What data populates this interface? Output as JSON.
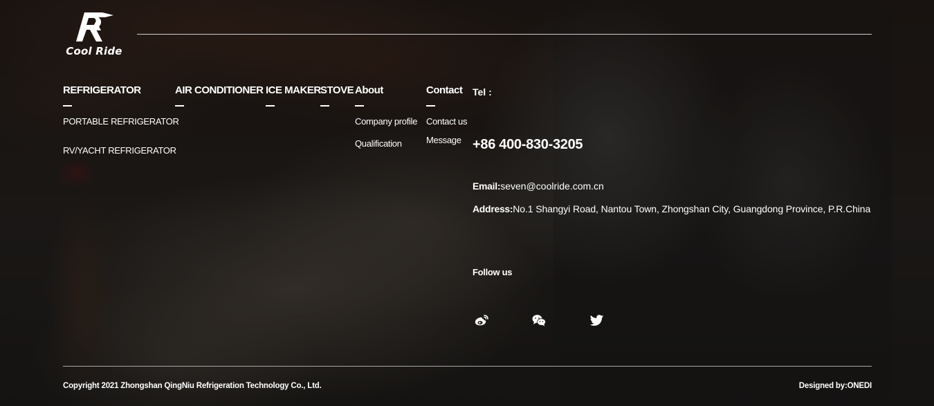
{
  "brand": {
    "name": "Cool Ride"
  },
  "nav": {
    "columns": [
      {
        "title": "REFRIGERATOR",
        "links": [
          "PORTABLE REFRIGERATOR",
          "RV/YACHT REFRIGERATOR"
        ]
      },
      {
        "title": "AIR CONDITIONER",
        "links": []
      },
      {
        "title": "ICE MAKER",
        "links": []
      },
      {
        "title": "STOVE",
        "links": []
      },
      {
        "title": "About",
        "links": [
          "Company profile",
          "Qualification"
        ]
      },
      {
        "title": "Contact",
        "links": [
          "Contact us",
          "Message"
        ]
      }
    ]
  },
  "contact": {
    "tel_label": "Tel :",
    "tel": "+86 400-830-3205",
    "email_label": "Email:",
    "email": "seven@coolride.com.cn",
    "address_label": "Address:",
    "address": "No.1 Shangyi Road, Nantou Town, Zhongshan City, Guangdong Province, P.R.China",
    "follow_label": "Follow us",
    "social_icons": [
      "weibo-icon",
      "wechat-icon",
      "twitter-icon"
    ]
  },
  "footer": {
    "copyright": "Copyright 2021 Zhongshan QingNiu Refrigeration Technology Co., Ltd.",
    "designed_by": "Designed by:ONEDI"
  },
  "colors": {
    "text": "#ffffff",
    "rule": "#cfcfcf",
    "overlay": "#1c1a18"
  }
}
